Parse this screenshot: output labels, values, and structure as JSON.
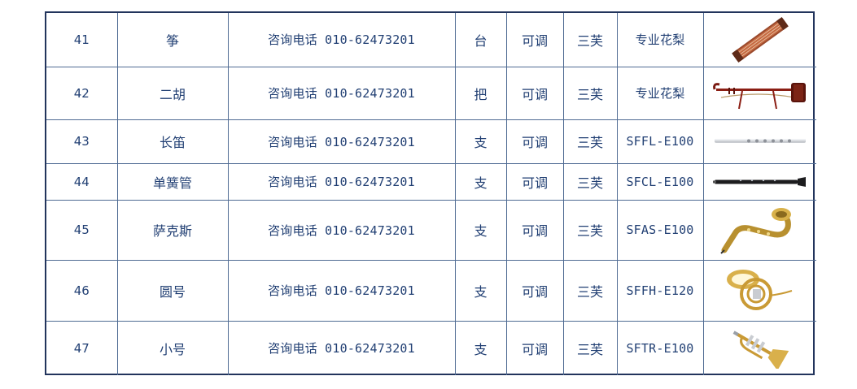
{
  "rows": [
    {
      "no": "41",
      "name": "筝",
      "price": "咨询电话 010-62473201",
      "unit": "台",
      "adj": "可调",
      "brand": "三芙",
      "model": "专业花梨",
      "icon": "guzheng-icon"
    },
    {
      "no": "42",
      "name": "二胡",
      "price": "咨询电话 010-62473201",
      "unit": "把",
      "adj": "可调",
      "brand": "三芙",
      "model": "专业花梨",
      "icon": "erhu-icon"
    },
    {
      "no": "43",
      "name": "长笛",
      "price": "咨询电话 010-62473201",
      "unit": "支",
      "adj": "可调",
      "brand": "三芙",
      "model": "SFFL-E100",
      "icon": "flute-icon"
    },
    {
      "no": "44",
      "name": "单簧管",
      "price": "咨询电话 010-62473201",
      "unit": "支",
      "adj": "可调",
      "brand": "三芙",
      "model": "SFCL-E100",
      "icon": "clarinet-icon"
    },
    {
      "no": "45",
      "name": "萨克斯",
      "price": "咨询电话 010-62473201",
      "unit": "支",
      "adj": "可调",
      "brand": "三芙",
      "model": "SFAS-E100",
      "icon": "saxophone-icon"
    },
    {
      "no": "46",
      "name": "圆号",
      "price": "咨询电话 010-62473201",
      "unit": "支",
      "adj": "可调",
      "brand": "三芙",
      "model": "SFFH-E120",
      "icon": "french-horn-icon"
    },
    {
      "no": "47",
      "name": "小号",
      "price": "咨询电话 010-62473201",
      "unit": "支",
      "adj": "可调",
      "brand": "三芙",
      "model": "SFTR-E100",
      "icon": "trumpet-icon"
    }
  ],
  "colors": {
    "text": "#213f73",
    "border": "#4f6b93",
    "frame": "#22345c"
  }
}
